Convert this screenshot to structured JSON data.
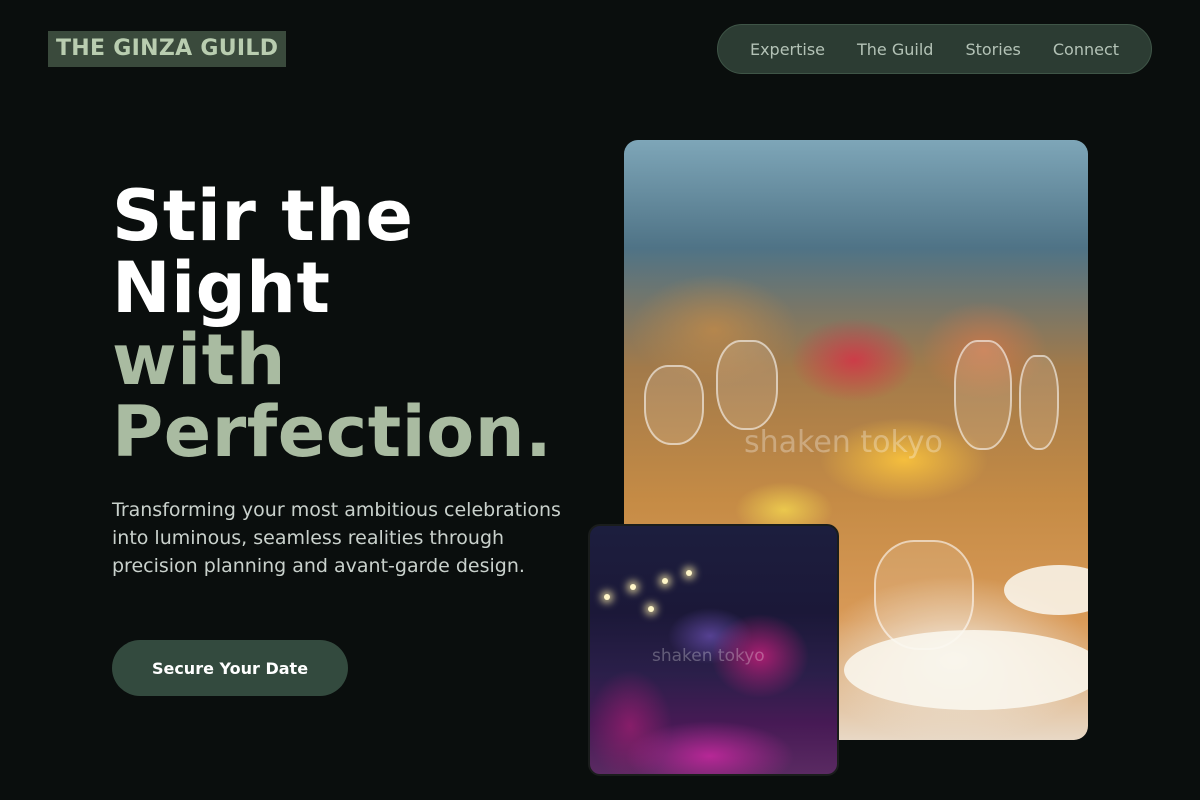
{
  "brand": {
    "name": "THE GINZA GUILD"
  },
  "nav": {
    "items": [
      {
        "label": "Expertise"
      },
      {
        "label": "The Guild"
      },
      {
        "label": "Stories"
      },
      {
        "label": "Connect"
      }
    ]
  },
  "hero": {
    "headline": {
      "line1": "Stir the",
      "line2": "Night",
      "line3": "with",
      "line4": "Perfection."
    },
    "subtitle": "Transforming your most ambitious celebrations into luminous, seamless realities through precision planning and avant-garde design.",
    "cta_label": "Secure Your Date"
  },
  "images": {
    "main": {
      "watermark": "shaken tokyo"
    },
    "inset": {
      "watermark": "shaken tokyo"
    }
  },
  "colors": {
    "background": "#0a0e0d",
    "accent_green": "#a9bba1",
    "nav_bg": "#2c3c33",
    "cta_bg": "#334a3e"
  }
}
